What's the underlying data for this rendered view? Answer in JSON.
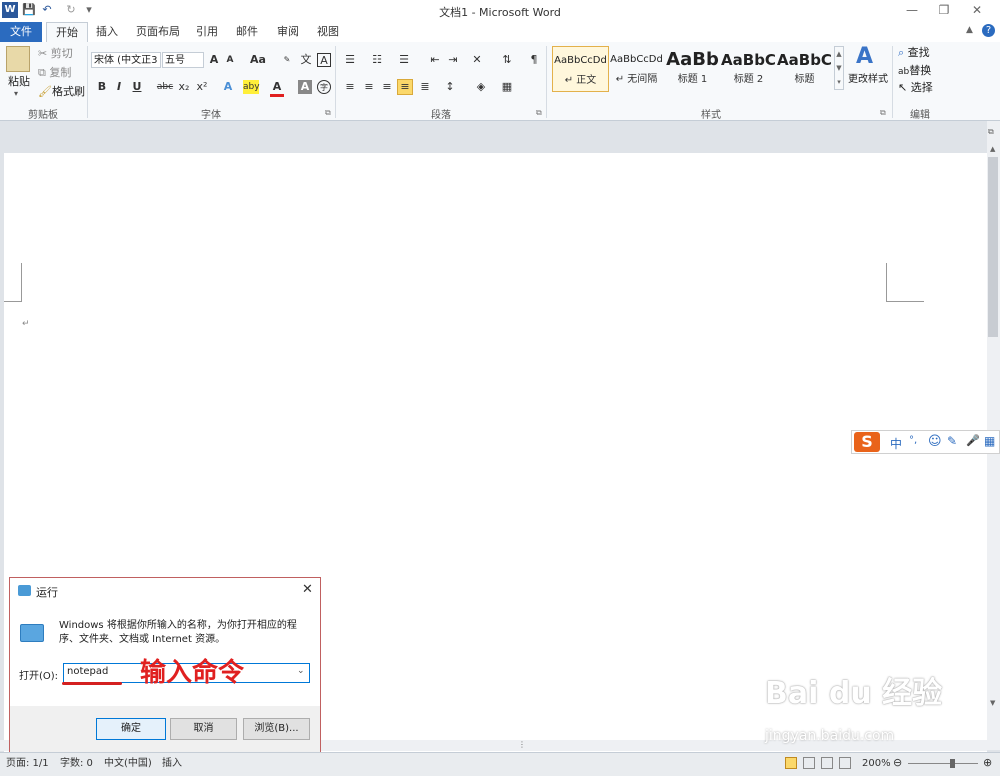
{
  "window": {
    "title": "文档1 - Microsoft Word",
    "app_icon": "W"
  },
  "quick_access": {
    "save_icon": "💾",
    "undo_icon": "↶",
    "redo_icon": "↻",
    "customize_icon": "▾"
  },
  "window_controls": {
    "minimize": "—",
    "restore": "❐",
    "close": "✕"
  },
  "tabs": [
    {
      "label": "文件"
    },
    {
      "label": "开始"
    },
    {
      "label": "插入"
    },
    {
      "label": "页面布局"
    },
    {
      "label": "引用"
    },
    {
      "label": "邮件"
    },
    {
      "label": "审阅"
    },
    {
      "label": "视图"
    }
  ],
  "ribbon_right": {
    "help": "?",
    "collapse": "▲"
  },
  "clipboard": {
    "paste": "粘贴",
    "cut": "剪切",
    "copy": "复制",
    "format_painter": "格式刷",
    "group_label": "剪贴板"
  },
  "font": {
    "font_name": "宋体 (中文正3",
    "font_size": "五号",
    "grow": "A",
    "shrink": "A",
    "change_case": "Aa",
    "phonetic": "ᵘᵉⁿ",
    "char_border": "A",
    "bold": "B",
    "italic": "I",
    "underline": "U",
    "strike": "abc",
    "subscript": "x₂",
    "superscript": "x²",
    "effects": "A",
    "highlight": "aby",
    "font_color": "A",
    "char_shading": "A",
    "enclose": "字",
    "group_label": "字体"
  },
  "paragraph": {
    "group_label": "段落"
  },
  "styles": {
    "items": [
      {
        "preview": "AaBbCcDd",
        "name": "↵ 正文"
      },
      {
        "preview": "AaBbCcDd",
        "name": "↵ 无间隔"
      },
      {
        "preview": "AaBb",
        "name": "标题 1"
      },
      {
        "preview": "AaBbC",
        "name": "标题 2"
      },
      {
        "preview": "AaBbC",
        "name": "标题"
      }
    ],
    "change_styles": "更改样式",
    "group_label": "样式"
  },
  "editing": {
    "find": "查找",
    "replace": "替换",
    "select": "选择",
    "group_label": "编辑"
  },
  "document": {
    "para_mark": "↵"
  },
  "ime": {
    "logo": "S",
    "items": [
      "中",
      "°,",
      "☺",
      "✎",
      "🎤",
      "▦"
    ]
  },
  "run_dialog": {
    "title": "运行",
    "description": "Windows 将根据你所输入的名称，为你打开相应的程序、文件夹、文档或 Internet 资源。",
    "open_label": "打开(O):",
    "input_value": "notepad",
    "ok": "确定",
    "cancel": "取消",
    "browse": "浏览(B)..."
  },
  "annotation": "输入命令",
  "statusbar": {
    "page": "页面: 1/1",
    "words": "字数: 0",
    "language": "中文(中国)",
    "mode": "插入",
    "zoom": "200%"
  },
  "watermark": {
    "brand": "Bai du 经验",
    "url": "jingyan.baidu.com"
  }
}
